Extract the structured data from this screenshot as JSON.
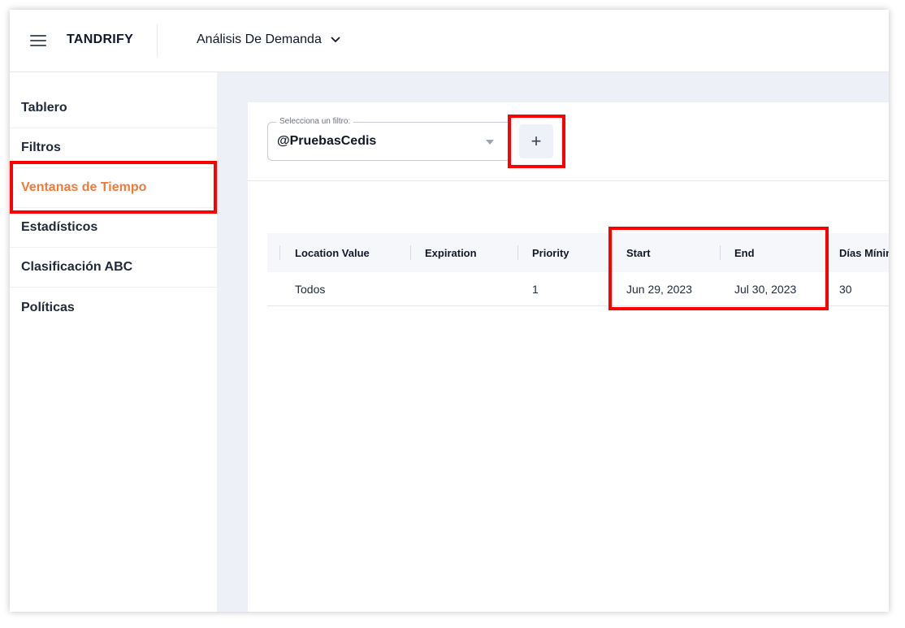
{
  "header": {
    "brand": "TANDRIFY",
    "module": "Análisis De Demanda"
  },
  "sidebar": {
    "items": [
      {
        "label": "Tablero"
      },
      {
        "label": "Filtros"
      },
      {
        "label": "Ventanas de Tiempo",
        "active": true
      },
      {
        "label": "Estadísticos"
      },
      {
        "label": "Clasificación ABC"
      },
      {
        "label": "Políticas"
      }
    ]
  },
  "filter": {
    "caption": "Selecciona un filtro:",
    "value": "@PruebasCedis",
    "add_label": "+"
  },
  "table": {
    "columns": [
      "Location Value",
      "Expiration",
      "Priority",
      "Start",
      "End",
      "Días Mínin"
    ],
    "rows": [
      [
        "Todos",
        "",
        "1",
        "Jun 29, 2023",
        "Jul 30, 2023",
        "30"
      ]
    ]
  },
  "colors": {
    "accent": "#f07a3a",
    "annotation": "#ff0000",
    "main_bg": "#edf0f7"
  }
}
